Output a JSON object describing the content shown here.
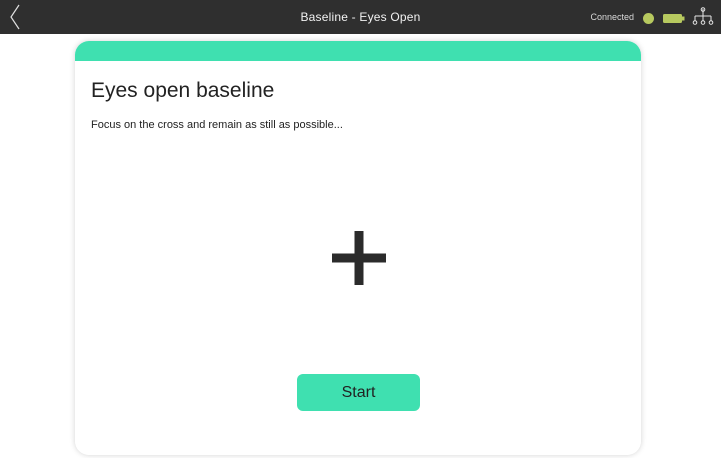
{
  "topbar": {
    "title": "Baseline - Eyes Open",
    "status_label": "Connected",
    "colors": {
      "background": "#2f2f2f",
      "status_dot": "#b7c95f",
      "battery": "#b7c95f"
    },
    "icons": {
      "back": "chevron-left-icon",
      "battery": "battery-icon",
      "network": "network-nodes-icon"
    }
  },
  "card": {
    "title": "Eyes open baseline",
    "subtitle": "Focus on the cross and remain as still as possible...",
    "fixation_icon": "plus-cross-icon",
    "start_label": "Start",
    "accent_color": "#3fe0b0"
  }
}
